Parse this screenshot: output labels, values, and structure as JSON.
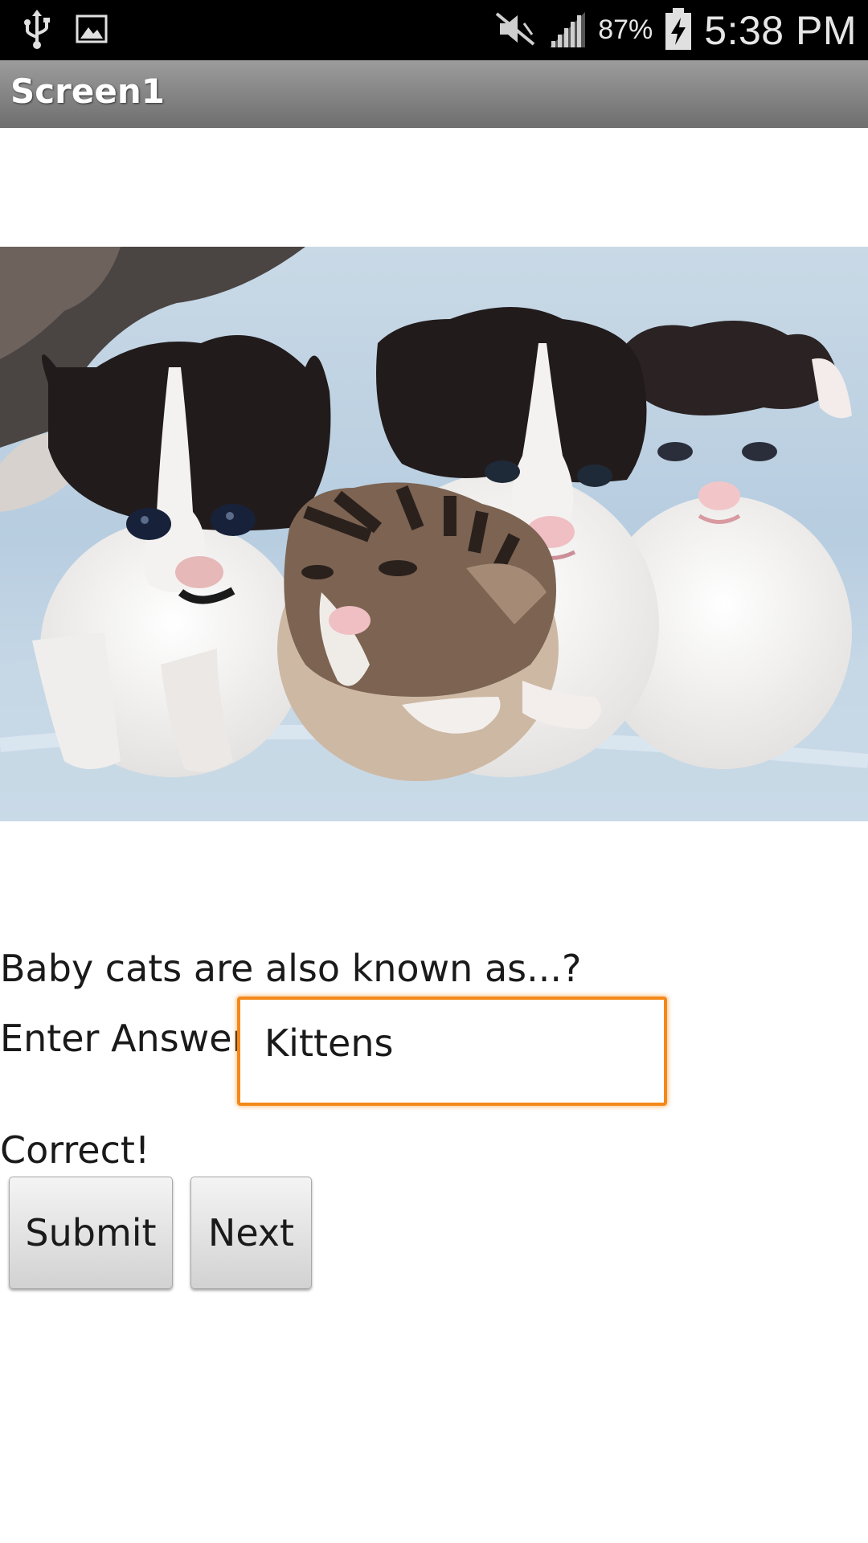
{
  "status_bar": {
    "battery_percent": "87%",
    "time": "5:38 PM",
    "icons": [
      "usb-icon",
      "image-notification-icon",
      "mute-icon",
      "signal-icon",
      "battery-charging-icon"
    ]
  },
  "title_bar": {
    "title": "Screen1",
    "background_color": "#7f7f7f"
  },
  "photo": {
    "subject": "kittens-photo"
  },
  "quiz": {
    "question": "Baby cats are also known as...?",
    "answer_label": "Enter Answer:",
    "answer_value": "Kittens",
    "result_text": "Correct!",
    "focus_color": "#f2891a"
  },
  "buttons": {
    "submit_label": "Submit",
    "next_label": "Next"
  }
}
